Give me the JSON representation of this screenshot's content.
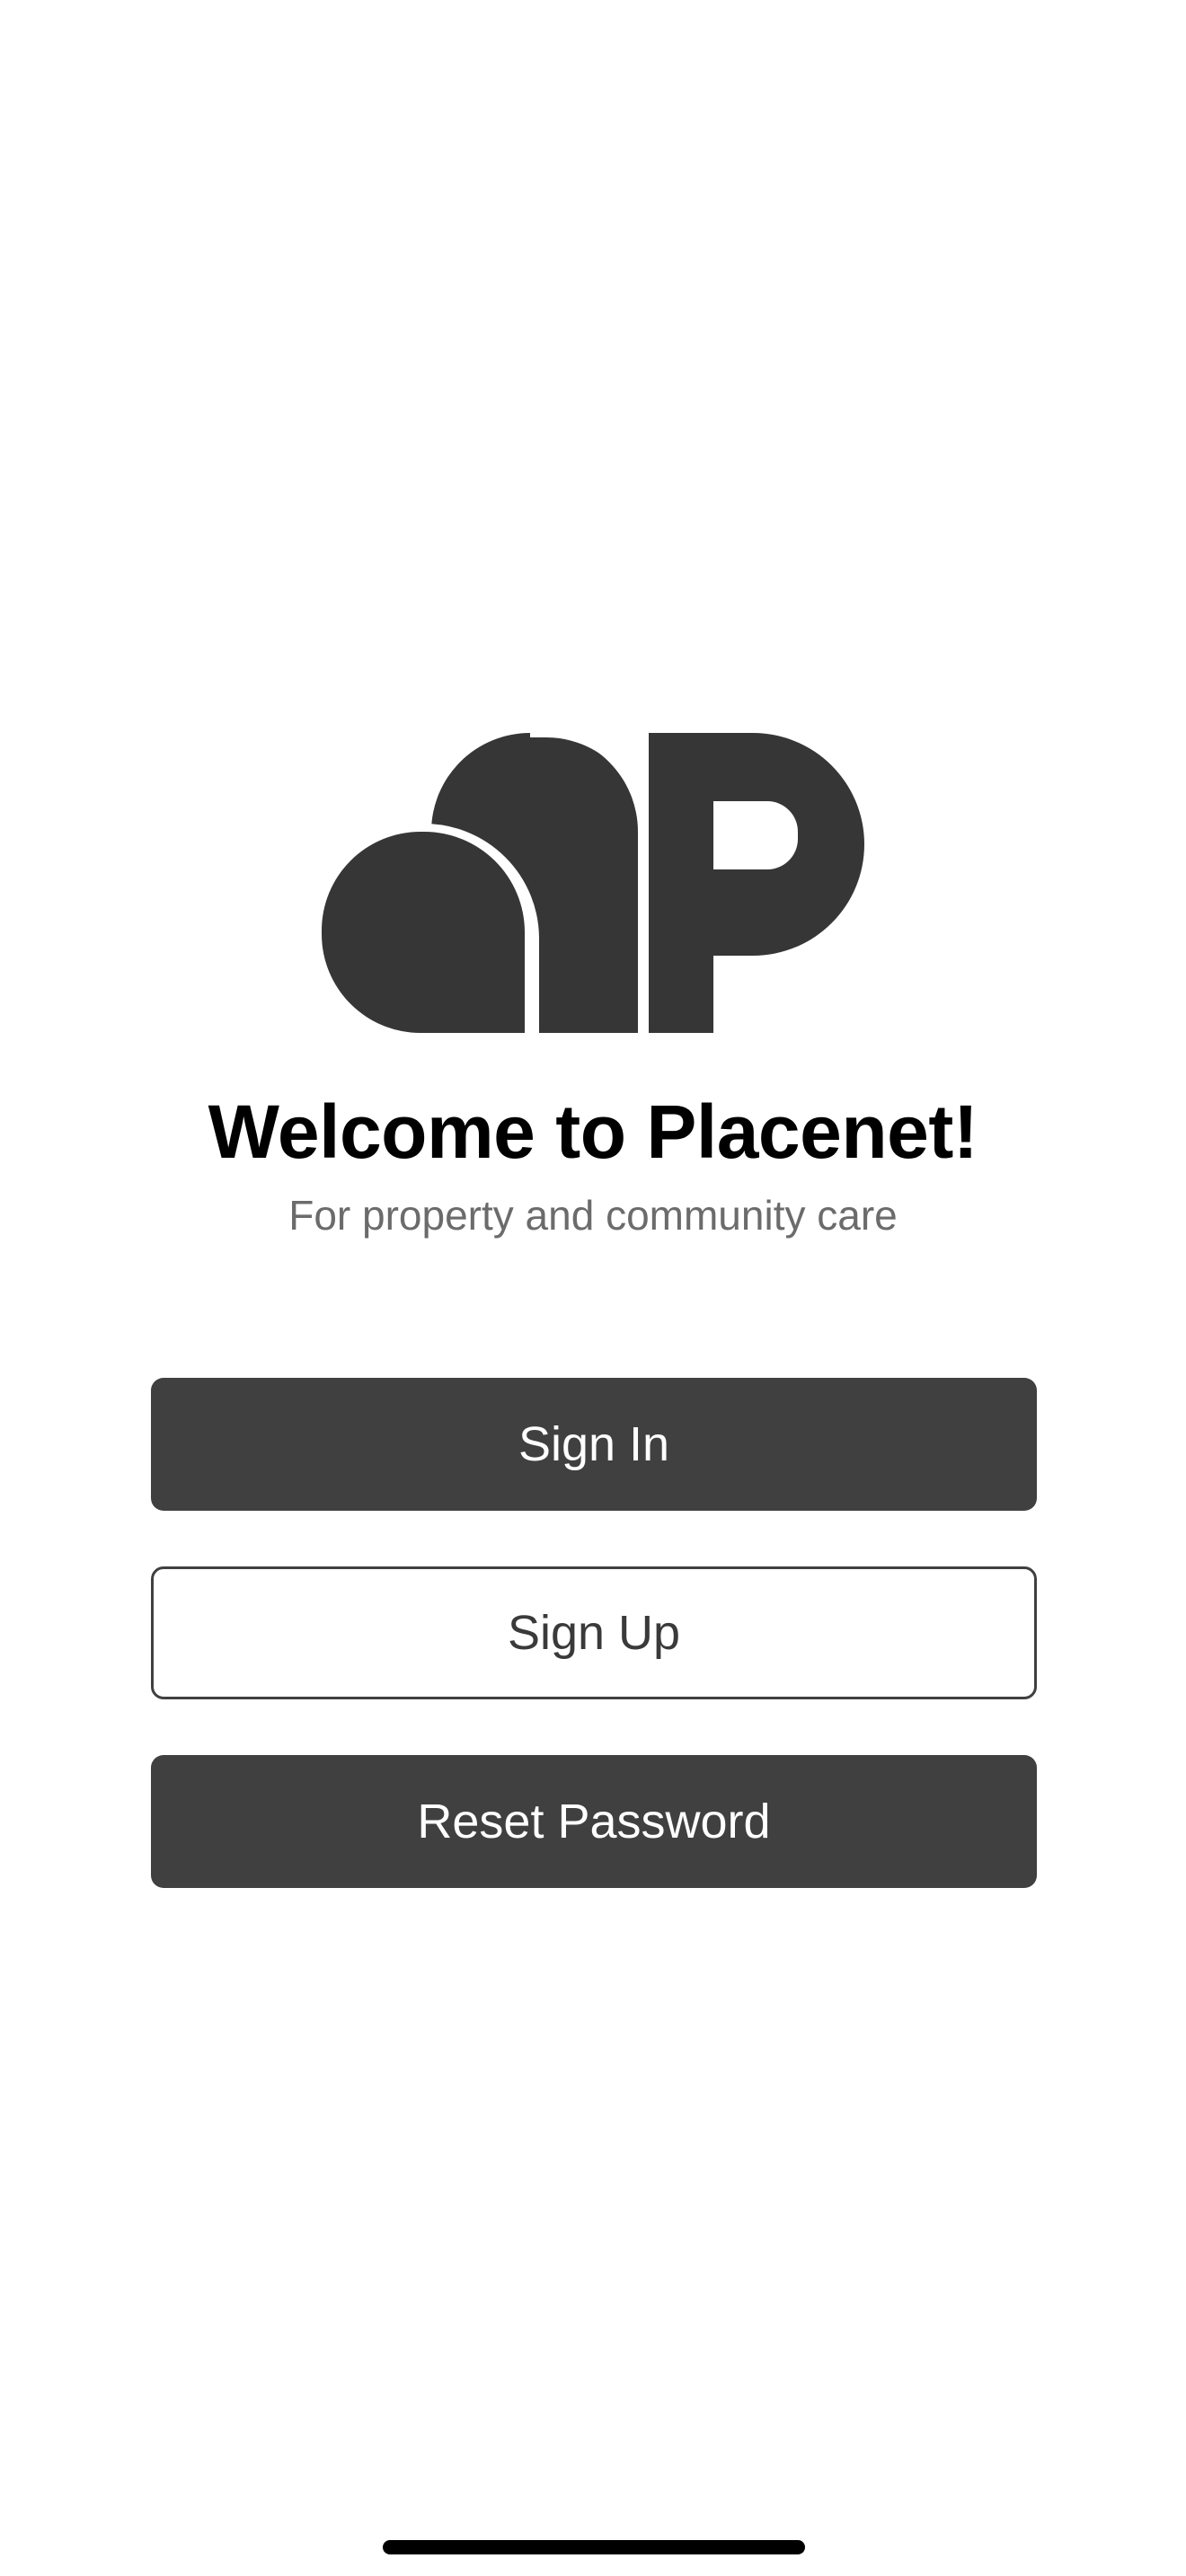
{
  "welcome": {
    "title": "Welcome to Placenet!",
    "subtitle": "For property and community care"
  },
  "logo": {
    "icon": "placenet-logo-icon",
    "color": "#363636"
  },
  "buttons": {
    "sign_in": "Sign In",
    "sign_up": "Sign Up",
    "reset_password": "Reset Password"
  },
  "colors": {
    "primary_button": "#404040",
    "title_text": "#000000",
    "subtitle_text": "#6b6b6b",
    "background": "#ffffff"
  }
}
